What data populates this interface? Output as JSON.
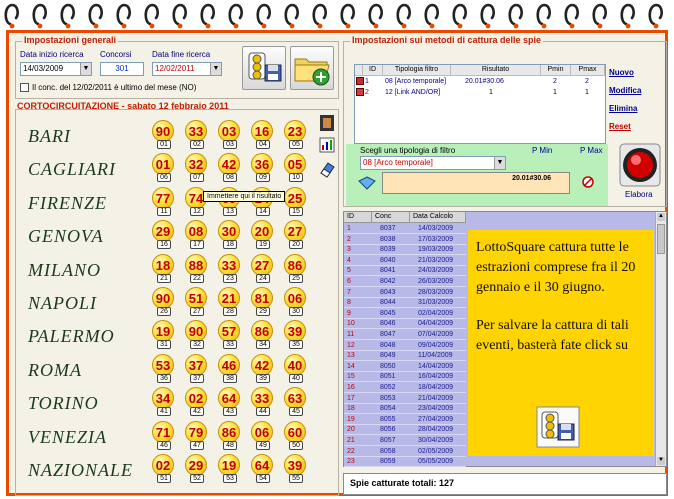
{
  "general": {
    "legend": "Impostazioni generali",
    "start_label": "Data inizio ricerca",
    "start_value": "14/03/2009",
    "contest_label": "Concorsi",
    "contest_value": "301",
    "end_label": "Data fine ricerca",
    "end_value": "12/02/2011",
    "checkbox_label": "Il conc. del 12/02/2011 è ultimo del mese (NO)"
  },
  "draws": {
    "title": "CORTOCIRCUITAZIONE - sabato 12 febbraio 2011",
    "rows": [
      {
        "name": "BARI",
        "nums": [
          "90",
          "33",
          "03",
          "16",
          "23"
        ],
        "caps": [
          "01",
          "02",
          "03",
          "04",
          "05"
        ]
      },
      {
        "name": "CAGLIARI",
        "nums": [
          "01",
          "32",
          "42",
          "36",
          "05"
        ],
        "caps": [
          "06",
          "07",
          "08",
          "09",
          "10"
        ]
      },
      {
        "name": "FIRENZE",
        "nums": [
          "77",
          "74",
          "69",
          "24",
          "25"
        ],
        "caps": [
          "11",
          "12",
          "13",
          "14",
          "15"
        ]
      },
      {
        "name": "GENOVA",
        "nums": [
          "29",
          "08",
          "30",
          "20",
          "27"
        ],
        "caps": [
          "16",
          "17",
          "18",
          "19",
          "20"
        ]
      },
      {
        "name": "MILANO",
        "nums": [
          "18",
          "88",
          "33",
          "27",
          "86"
        ],
        "caps": [
          "21",
          "22",
          "23",
          "24",
          "25"
        ]
      },
      {
        "name": "NAPOLI",
        "nums": [
          "90",
          "51",
          "21",
          "81",
          "06"
        ],
        "caps": [
          "26",
          "27",
          "28",
          "29",
          "30"
        ]
      },
      {
        "name": "PALERMO",
        "nums": [
          "19",
          "90",
          "57",
          "86",
          "39"
        ],
        "caps": [
          "31",
          "32",
          "33",
          "34",
          "35"
        ]
      },
      {
        "name": "ROMA",
        "nums": [
          "53",
          "37",
          "46",
          "42",
          "40"
        ],
        "caps": [
          "36",
          "37",
          "38",
          "39",
          "40"
        ]
      },
      {
        "name": "TORINO",
        "nums": [
          "34",
          "02",
          "64",
          "33",
          "63"
        ],
        "caps": [
          "41",
          "42",
          "43",
          "44",
          "45"
        ]
      },
      {
        "name": "VENEZIA",
        "nums": [
          "71",
          "79",
          "86",
          "06",
          "60"
        ],
        "caps": [
          "46",
          "47",
          "48",
          "49",
          "50"
        ]
      },
      {
        "name": "NAZIONALE",
        "nums": [
          "02",
          "29",
          "19",
          "64",
          "39"
        ],
        "caps": [
          "51",
          "52",
          "53",
          "54",
          "55"
        ]
      }
    ]
  },
  "methods": {
    "legend": "Impostazioni sui metodi di cattura delle spie",
    "columns": [
      "ID",
      "Tipologia filtro",
      "Risultato",
      "Pmin",
      "Pmax"
    ],
    "rows": [
      {
        "id": "1",
        "type": "08 [Arco temporale]",
        "result": "20.01#30.06",
        "pmin": "2",
        "pmax": "2"
      },
      {
        "id": "2",
        "type": "12 [Link AND/OR]",
        "result": "1",
        "pmin": "1",
        "pmax": "1"
      }
    ],
    "buttons": {
      "new": "Nuovo",
      "edit": "Modifica",
      "delete": "Elimina",
      "reset": "Reset"
    },
    "choose_label": "Scegli una tipologia di filtro",
    "choose_value": "08 [Arco temporale]",
    "pmin_label": "P Min",
    "pmax_label": "P Max",
    "result_value": "20.01#30.06",
    "elabora": "Elabora",
    "tooltip": "Immettere qui il risultato"
  },
  "history": {
    "columns": [
      "ID",
      "Conc",
      "Data Calcolo"
    ],
    "rows": [
      {
        "id": "1",
        "conc": "8037",
        "date": "14/03/2009"
      },
      {
        "id": "2",
        "conc": "8038",
        "date": "17/03/2009"
      },
      {
        "id": "3",
        "conc": "8039",
        "date": "19/03/2009"
      },
      {
        "id": "4",
        "conc": "8040",
        "date": "21/03/2009"
      },
      {
        "id": "5",
        "conc": "8041",
        "date": "24/03/2009"
      },
      {
        "id": "6",
        "conc": "8042",
        "date": "26/03/2009"
      },
      {
        "id": "7",
        "conc": "8043",
        "date": "28/03/2009"
      },
      {
        "id": "8",
        "conc": "8044",
        "date": "31/03/2009"
      },
      {
        "id": "9",
        "conc": "8045",
        "date": "02/04/2009"
      },
      {
        "id": "10",
        "conc": "8046",
        "date": "04/04/2009"
      },
      {
        "id": "11",
        "conc": "8047",
        "date": "07/04/2009"
      },
      {
        "id": "12",
        "conc": "8048",
        "date": "09/04/2009"
      },
      {
        "id": "13",
        "conc": "8049",
        "date": "11/04/2009"
      },
      {
        "id": "14",
        "conc": "8050",
        "date": "14/04/2009"
      },
      {
        "id": "15",
        "conc": "8051",
        "date": "16/04/2009"
      },
      {
        "id": "16",
        "conc": "8052",
        "date": "18/04/2009"
      },
      {
        "id": "17",
        "conc": "8053",
        "date": "21/04/2009"
      },
      {
        "id": "18",
        "conc": "8054",
        "date": "23/04/2009"
      },
      {
        "id": "19",
        "conc": "8055",
        "date": "27/04/2009"
      },
      {
        "id": "20",
        "conc": "8056",
        "date": "28/04/2009"
      },
      {
        "id": "21",
        "conc": "8057",
        "date": "30/04/2009"
      },
      {
        "id": "22",
        "conc": "8058",
        "date": "02/05/2009"
      },
      {
        "id": "23",
        "conc": "8059",
        "date": "05/05/2009"
      }
    ],
    "note_p1": "LottoSquare cattura tutte le estrazioni comprese fra il 20 gennaio e il 30 giugno.",
    "note_p2": "Per salvare la cattura di tali eventi, basterà fate click su",
    "footer": "Spie catturate totali: 127"
  },
  "colors": {
    "accent": "#e84a00",
    "legend": "#c02000",
    "ball_text": "#c00000",
    "note_bg": "#ffd400",
    "grid_bg": "#b9b9e8"
  },
  "icons": [
    "spiral-ring-icon",
    "lightbulb-save-icon",
    "folder-add-icon",
    "result-icon",
    "elabora-target-icon",
    "diamond-icon",
    "no-entry-icon"
  ]
}
